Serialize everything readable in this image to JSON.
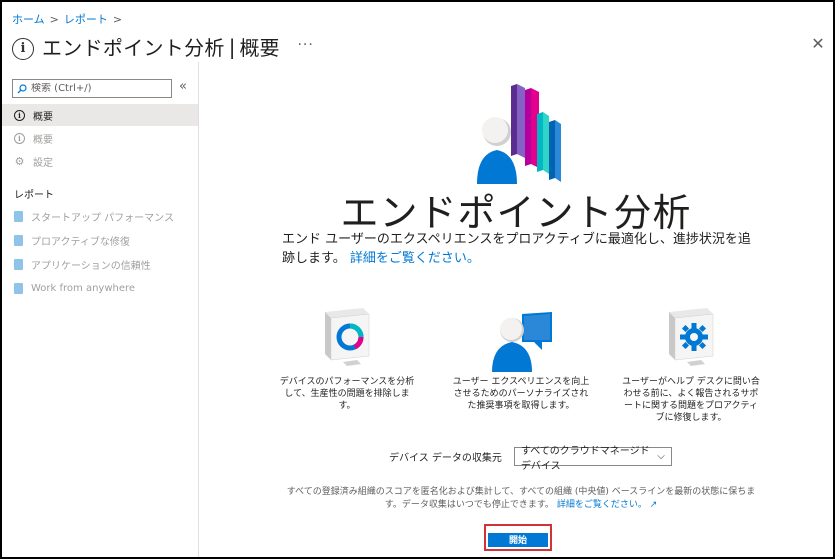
{
  "breadcrumb": {
    "home": "ホーム",
    "reports": "レポート"
  },
  "header": {
    "title": "エンドポイント分析",
    "separator": "|",
    "subtitle": "概要",
    "more": "···",
    "close": "✕"
  },
  "sidebar": {
    "search_placeholder": "検索 (Ctrl+/)",
    "collapse": "«",
    "items": [
      {
        "label": "概要",
        "icon": "info-icon",
        "active": true
      },
      {
        "label": "概要",
        "icon": "info-icon",
        "active": false
      },
      {
        "label": "設定",
        "icon": "gear-icon",
        "active": false
      }
    ],
    "section_label": "レポート",
    "reports": [
      {
        "label": "スタートアップ パフォーマンス"
      },
      {
        "label": "プロアクティブな修復"
      },
      {
        "label": "アプリケーションの信頼性"
      },
      {
        "label": "Work from anywhere"
      }
    ]
  },
  "main": {
    "hero_title": "エンドポイント分析",
    "description": "エンド ユーザーのエクスペリエンスをプロアクティブに最適化し、進捗状況を追跡します。",
    "description_link": "詳細をご覧ください。",
    "features": [
      {
        "text": "デバイスのパフォーマンスを分析して、生産性の問題を排除します。"
      },
      {
        "text": "ユーザー エクスペリエンスを向上させるためのパーソナライズされた推奨事項を取得します。"
      },
      {
        "text": "ユーザーがヘルプ デスクに問い合わせる前に、よく報告されるサポートに関する問題をプロアクティブに修復します。"
      }
    ],
    "source_label": "デバイス データの収集元",
    "source_value": "すべてのクラウドマネージド デバイス",
    "privacy_text": "すべての登録済み組織のスコアを匿名化および集計して、すべての組織 (中央値) ベースラインを最新の状態に保ちます。データ収集はいつでも停止できます。",
    "privacy_link": "詳細をご覧ください。",
    "start_label": "開始"
  },
  "colors": {
    "accent": "#0078d4",
    "highlight": "#d13438"
  }
}
